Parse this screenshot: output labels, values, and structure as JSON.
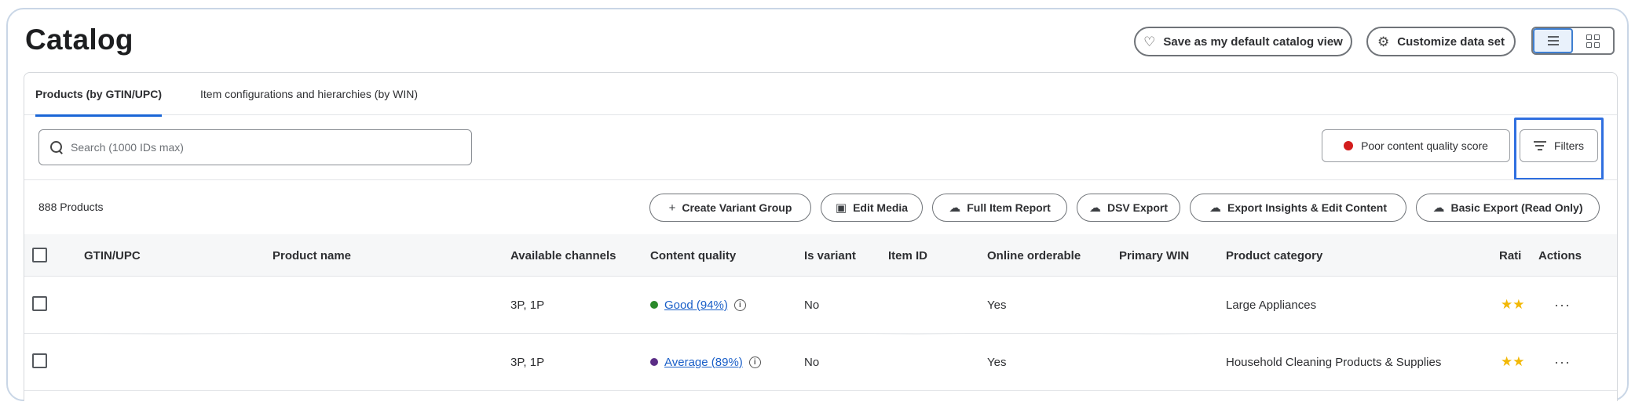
{
  "page_title": "Catalog",
  "header_actions": {
    "save_default_label": "Save as my default catalog view",
    "customize_label": "Customize data set"
  },
  "tabs": [
    {
      "label": "Products (by GTIN/UPC)",
      "active": true
    },
    {
      "label": "Item configurations and hierarchies (by WIN)",
      "active": false
    }
  ],
  "search": {
    "placeholder": "Search (1000 IDs max)",
    "value": ""
  },
  "poor_quality_label": "Poor content quality score",
  "filters_label": "Filters",
  "product_count": "888 Products",
  "actions": [
    {
      "label": "Create Variant Group",
      "icon": "plus-icon"
    },
    {
      "label": "Edit Media",
      "icon": "image-edit-icon"
    },
    {
      "label": "Full Item Report",
      "icon": "cloud-download-icon"
    },
    {
      "label": "DSV Export",
      "icon": "cloud-download-icon"
    },
    {
      "label": "Export Insights & Edit Content",
      "icon": "cloud-download-icon"
    },
    {
      "label": "Basic Export (Read Only)",
      "icon": "cloud-download-icon"
    }
  ],
  "columns": [
    "GTIN/UPC",
    "Product name",
    "Available channels",
    "Content quality",
    "Is variant",
    "Item ID",
    "Online orderable",
    "Primary WIN",
    "Product category",
    "Rati",
    "Actions"
  ],
  "rows": [
    {
      "gtin": "",
      "product_name": "",
      "channels": "3P, 1P",
      "quality": "Good (94%)",
      "quality_color": "#2a8a2a",
      "is_variant": "No",
      "item_id": "",
      "online_orderable": "Yes",
      "primary_win": "",
      "category": "Large Appliances",
      "rating": "★★",
      "actions": "···"
    },
    {
      "gtin": "",
      "product_name": "",
      "channels": "3P, 1P",
      "quality": "Average (89%)",
      "quality_color": "#5b2d86",
      "is_variant": "No",
      "item_id": "",
      "online_orderable": "Yes",
      "primary_win": "",
      "category": "Household Cleaning Products & Supplies",
      "rating": "★★",
      "actions": "···"
    }
  ],
  "colors": {
    "accent": "#1a66d6",
    "poor_quality": "#d31d1d",
    "star": "#f2b806",
    "highlight_border": "#2f6fe0"
  }
}
